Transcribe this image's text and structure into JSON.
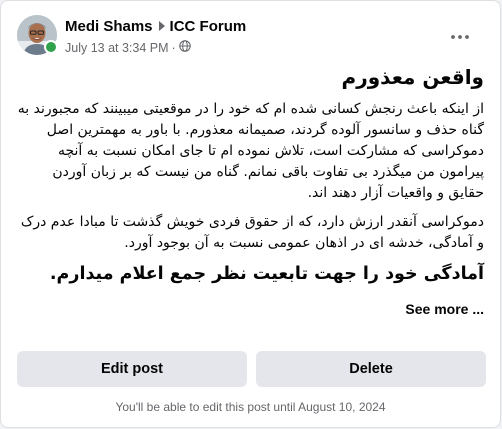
{
  "post": {
    "author": "Medi Shams",
    "group": "ICC Forum",
    "date": "July 13 at 3:34 PM",
    "separator": "·",
    "privacy_icon": "globe-icon",
    "title": "واقعن معذورم",
    "paragraph_1": "از اینکه باعث رنجش کسانی شده ام که خود را در موقعیتی میبینند که مجبورند به گناه حذف و سانسور آلوده گردند، صمیمانه معذورم. با باور به مهمترین اصل دموکراسی که مشارکت است، تلاش نموده ام تا جای امکان نسبت به آنچه پیرامون من میگذرد بی تفاوت باقی نمانم. گناه من نیست که بر زبان آوردن حقایق و واقعیات آزار دهند اند.",
    "paragraph_2": "دموکراسی آنقدر ارزش دارد، که از حقوق فردی خویش گذشت تا مبادا عدم درک و آمادگی، خدشه ای در اذهان عمومی نسبت به آن بوجود آورد.",
    "paragraph_3": "آمادگی خود را جهت تابعیت نظر جمع اعلام میدارم.",
    "see_more": "See more ..."
  },
  "actions": {
    "edit": "Edit post",
    "delete": "Delete"
  },
  "footer_note": "You'll be able to edit this post until August 10, 2024",
  "colors": {
    "online": "#31a24c",
    "button_bg": "#e4e6eb",
    "secondary_text": "#65676b"
  }
}
